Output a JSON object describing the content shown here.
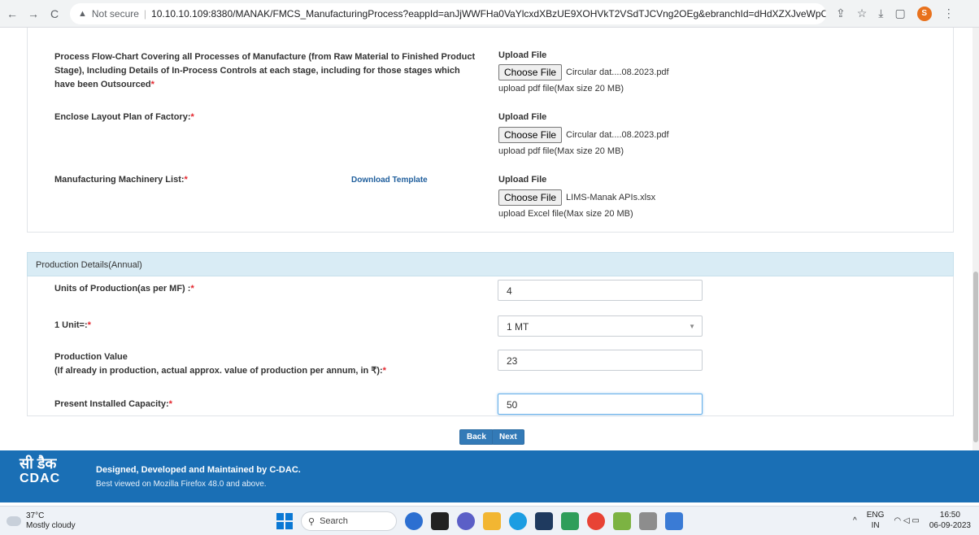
{
  "browser": {
    "back": "←",
    "forward": "→",
    "reload": "C",
    "warning_icon": "▲",
    "not_secure": "Not secure",
    "separator": "|",
    "url": "10.10.10.109:8380/MANAK/FMCS_ManufacturingProcess?eappId=anJjWWFHa0VaYlcxdXBzUE9XOHVkT2VSdTJCVng2OEg&ebranchId=dHdXZXJveWpCYVp6YitwdVBrN2NQZz09",
    "profile_initial": "S"
  },
  "uploads": [
    {
      "label": "Process Flow-Chart Covering all Processes of Manufacture (from Raw Material to Finished Product Stage), Including Details of In-Process Controls at each stage, including for those stages which have been Outsourced",
      "upload_title": "Upload File",
      "button": "Choose File",
      "file_name": "Circular dat....08.2023.pdf",
      "hint": "upload pdf file(Max size 20 MB)"
    },
    {
      "label": "Enclose Layout Plan of Factory:",
      "upload_title": "Upload File",
      "button": "Choose File",
      "file_name": "Circular dat....08.2023.pdf",
      "hint": "upload pdf file(Max size 20 MB)"
    },
    {
      "label": "Manufacturing Machinery List:",
      "download_template": "Download Template",
      "upload_title": "Upload File",
      "button": "Choose File",
      "file_name": "LIMS-Manak APIs.xlsx",
      "hint": "upload Excel file(Max size 20 MB)"
    }
  ],
  "production": {
    "section_title": "Production Details(Annual)",
    "required_mark": "*",
    "units_label": "Units of Production(as per MF) :",
    "units_value": "4",
    "unit_label": "1 Unit=:",
    "unit_value": "1 MT",
    "value_label": "Production Value",
    "value_sublabel": "(If already in production, actual approx. value of production per annum, in ₹):",
    "value_value": "23",
    "capacity_label": "Present Installed Capacity:",
    "capacity_value": "50"
  },
  "buttons": {
    "back": "Back",
    "next": "Next"
  },
  "footer": {
    "logo_hindi": "सी डैक",
    "logo_en": "CDAC",
    "line1": "Designed, Developed and Maintained by C-DAC.",
    "line2": "Best viewed on Mozilla Firefox 48.0 and above."
  },
  "taskbar": {
    "temperature": "37°C",
    "weather": "Mostly cloudy",
    "search": "Search",
    "lang_top": "ENG",
    "lang_bottom": "IN",
    "time": "16:50",
    "date": "06-09-2023"
  }
}
